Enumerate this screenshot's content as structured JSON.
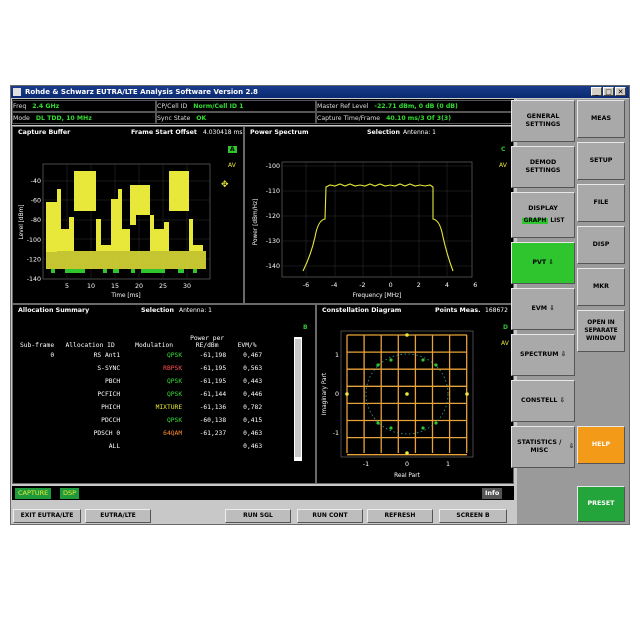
{
  "window": {
    "title": "Rohde & Schwarz EUTRA/LTE Analysis Software Version 2.8",
    "controls": [
      "_",
      "□",
      "✕"
    ]
  },
  "info": {
    "freq_label": "Freq",
    "freq_value": "2.4 GHz",
    "cpcell_label": "CP/Cell ID",
    "cpcell_value": "Norm/Cell ID 1",
    "mref_label": "Master Ref Level",
    "mref_value": "-22.71 dBm, 0 dB (0 dB)",
    "mode_label": "Mode",
    "mode_value": "DL TDD, 10 MHz",
    "sync_label": "Sync State",
    "sync_value": "OK",
    "capt_label": "Capture Time/Frame",
    "capt_value": "40.10 ms/3 Of 3(3)"
  },
  "capture": {
    "title": "Capture Buffer",
    "frame_label": "Frame Start Offset",
    "frame_value": "4.030418 ms",
    "badge": "A",
    "mode": "AV",
    "ylabel": "Level [dBm]",
    "xlabel": "Time [ms]",
    "yticks": [
      "-40",
      "-60",
      "-80",
      "-100",
      "-120",
      "-140"
    ],
    "xticks": [
      "5",
      "10",
      "15",
      "20",
      "25",
      "30"
    ]
  },
  "spectrum": {
    "title": "Power Spectrum",
    "sel_label": "Selection",
    "sel_value": "Antenna: 1",
    "badge": "C",
    "mode": "AV",
    "ylabel": "Power [dBm/Hz]",
    "xlabel": "Frequency [MHz]",
    "yticks": [
      "-100",
      "-110",
      "-120",
      "-130",
      "-140"
    ],
    "xticks": [
      "-6",
      "-4",
      "-2",
      "0",
      "2",
      "4",
      "6"
    ]
  },
  "alloc": {
    "title": "Allocation Summary",
    "sel_label": "Selection",
    "sel_value": "Antenna: 1",
    "badge": "B",
    "headers": [
      "Sub-frame",
      "Allocation ID",
      "Modulation",
      "Power per RE/dBm",
      "EVM/%"
    ],
    "rows": [
      {
        "sf": "0",
        "id": "RS Ant1",
        "mod": "QPSK",
        "mc": "mod-green",
        "pw": "-61,198",
        "evm": "0,467"
      },
      {
        "sf": "",
        "id": "S-SYNC",
        "mod": "RBPSK",
        "mc": "mod-red",
        "pw": "-61,195",
        "evm": "0,563"
      },
      {
        "sf": "",
        "id": "PBCH",
        "mod": "QPSK",
        "mc": "mod-green",
        "pw": "-61,195",
        "evm": "0,443"
      },
      {
        "sf": "",
        "id": "PCFICH",
        "mod": "QPSK",
        "mc": "mod-green",
        "pw": "-61,144",
        "evm": "0,446"
      },
      {
        "sf": "",
        "id": "PHICH",
        "mod": "MIXTURE",
        "mc": "mod-yellow",
        "pw": "-61,136",
        "evm": "0,782"
      },
      {
        "sf": "",
        "id": "PDCCH",
        "mod": "QPSK",
        "mc": "mod-green",
        "pw": "-60,138",
        "evm": "0,415"
      },
      {
        "sf": "",
        "id": "PDSCH 0",
        "mod": "64QAM",
        "mc": "mod-orange",
        "pw": "-61,237",
        "evm": "0,463"
      },
      {
        "sf": "",
        "id": "ALL",
        "mod": "",
        "mc": "",
        "pw": "",
        "evm": "0,463"
      }
    ]
  },
  "constellation": {
    "title": "Constellation Diagram",
    "points_label": "Points Meas.",
    "points_value": "168672",
    "badge": "D",
    "mode": "AV",
    "ylabel": "Imaginary Part",
    "xlabel": "Real Part",
    "xticks": [
      "-1",
      "0",
      "1"
    ],
    "yticks": [
      "1",
      "0",
      "-1"
    ]
  },
  "status": {
    "capture": "CAPTURE",
    "dsp": "DSP",
    "info": "Info"
  },
  "softkeys_bottom": [
    "EXIT EUTRA/LTE",
    "EUTRA/LTE",
    "RUN SGL",
    "RUN CONT",
    "REFRESH",
    "SCREEN B"
  ],
  "side_left": {
    "general": "GENERAL SETTINGS",
    "demod": "DEMOD SETTINGS",
    "display": "DISPLAY",
    "graph": "GRAPH",
    "list": "LIST",
    "pvt": "PVT",
    "evm": "EVM",
    "spectrum": "SPECTRUM",
    "constell": "CONSTELL",
    "statistics": "STATISTICS / MISC"
  },
  "side_right": {
    "meas": "MEAS",
    "setup": "SETUP",
    "file": "FILE",
    "disp": "DISP",
    "mkr": "MKR",
    "open": "OPEN IN SEPARATE WINDOW",
    "help": "HELP",
    "preset": "PRESET"
  },
  "colors": {
    "trace": "#e8e83a",
    "marker_green": "#2ec52e",
    "help": "#f39a19",
    "preset": "#23a53b"
  }
}
